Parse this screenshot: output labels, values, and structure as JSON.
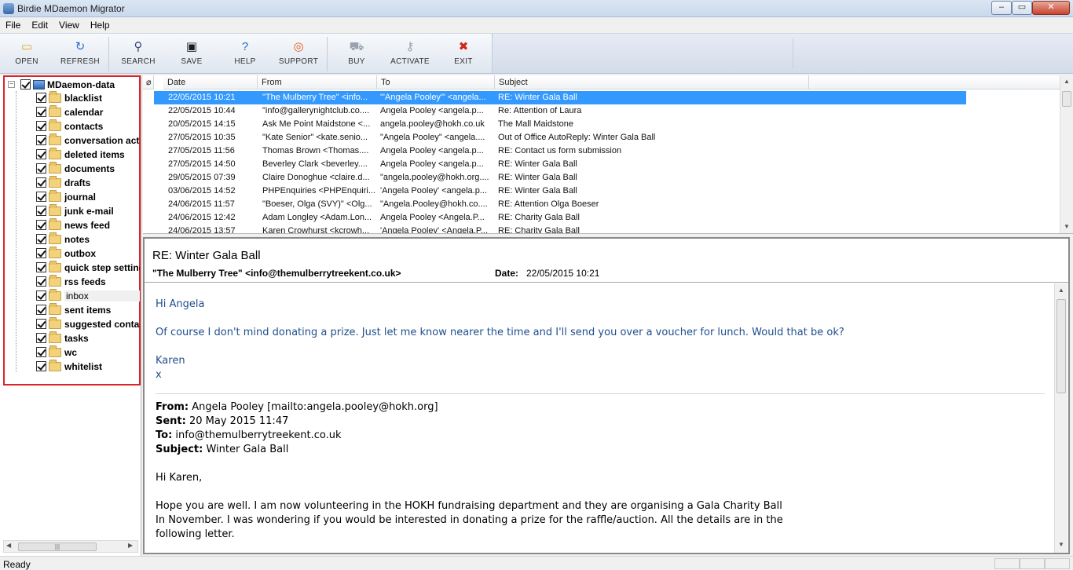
{
  "window": {
    "title": "Birdie MDaemon Migrator"
  },
  "menu": [
    "File",
    "Edit",
    "View",
    "Help"
  ],
  "toolbar": [
    {
      "label": "OPEN",
      "icon": "folder-open-icon",
      "glyph": "▭"
    },
    {
      "label": "REFRESH",
      "icon": "refresh-icon",
      "glyph": "↻"
    },
    {
      "label": "SEARCH",
      "icon": "search-icon",
      "glyph": "⚲"
    },
    {
      "label": "SAVE",
      "icon": "save-icon",
      "glyph": "▣"
    },
    {
      "label": "HELP",
      "icon": "help-icon",
      "glyph": "?"
    },
    {
      "label": "SUPPORT",
      "icon": "lifebuoy-icon",
      "glyph": "◎"
    },
    {
      "label": "BUY",
      "icon": "cart-icon",
      "glyph": "⛟"
    },
    {
      "label": "ACTIVATE",
      "icon": "key-icon",
      "glyph": "⚷"
    },
    {
      "label": "EXIT",
      "icon": "exit-icon",
      "glyph": "✖"
    }
  ],
  "tree": {
    "root": "MDaemon-data",
    "items": [
      "blacklist",
      "calendar",
      "contacts",
      "conversation acti",
      "deleted items",
      "documents",
      "drafts",
      "journal",
      "junk e-mail",
      "news feed",
      "notes",
      "outbox",
      "quick step setting",
      "rss feeds",
      "inbox",
      "sent items",
      "suggested contac",
      "tasks",
      "wc",
      "whitelist"
    ],
    "highlighted_item": "inbox"
  },
  "message_list": {
    "columns": [
      "Date",
      "From",
      "To",
      "Subject"
    ],
    "selected_index": 0,
    "rows": [
      {
        "date": "22/05/2015 10:21",
        "from": "\"The Mulberry Tree\" <info...",
        "to": "\"'Angela Pooley'\" <angela...",
        "subject": "RE: Winter Gala Ball"
      },
      {
        "date": "22/05/2015 10:44",
        "from": "\"info@gallerynightclub.co....",
        "to": "Angela Pooley <angela.p...",
        "subject": "Re: Attention of Laura"
      },
      {
        "date": "20/05/2015 14:15",
        "from": "Ask Me Point Maidstone <...",
        "to": "angela.pooley@hokh.co.uk",
        "subject": "The Mall Maidstone"
      },
      {
        "date": "27/05/2015 10:35",
        "from": "\"Kate Senior\" <kate.senio...",
        "to": "\"Angela Pooley\" <angela....",
        "subject": "Out of Office AutoReply: Winter Gala Ball"
      },
      {
        "date": "27/05/2015 11:56",
        "from": "Thomas Brown <Thomas....",
        "to": "Angela Pooley <angela.p...",
        "subject": "RE: Contact us form submission"
      },
      {
        "date": "27/05/2015 14:50",
        "from": "Beverley Clark <beverley....",
        "to": "Angela Pooley <angela.p...",
        "subject": "RE: Winter Gala Ball"
      },
      {
        "date": "29/05/2015 07:39",
        "from": "Claire Donoghue <claire.d...",
        "to": "\"angela.pooley@hokh.org....",
        "subject": "RE: Winter Gala Ball"
      },
      {
        "date": "03/06/2015 14:52",
        "from": "PHPEnquiries <PHPEnquiri...",
        "to": "'Angela Pooley' <angela.p...",
        "subject": "RE: Winter Gala Ball"
      },
      {
        "date": "24/06/2015 11:57",
        "from": "\"Boeser, Olga (SVY)\" <Olg...",
        "to": "\"Angela.Pooley@hokh.co....",
        "subject": "RE: Attention Olga Boeser"
      },
      {
        "date": "24/06/2015 12:42",
        "from": "Adam Longley <Adam.Lon...",
        "to": "Angela Pooley <Angela.P...",
        "subject": "RE: Charity Gala Ball"
      },
      {
        "date": "24/06/2015 13:57",
        "from": "Karen Crowhurst <kcrowh...",
        "to": "'Angela Pooley' <Angela.P...",
        "subject": "RE: Charity Gala Ball"
      }
    ]
  },
  "reader": {
    "subject": "RE: Winter Gala Ball",
    "from": "\"The Mulberry Tree\" <info@themulberrytreekent.co.uk>",
    "date_label": "Date:",
    "date_value": "22/05/2015 10:21",
    "greeting": "Hi Angela",
    "para1": "Of course I don't mind donating a prize.  Just let me know nearer the time and I'll send you over a voucher for lunch.  Would that be ok?",
    "sign1": "Karen",
    "sign2": "x",
    "quoted": {
      "from_label": "From:",
      "from_value": " Angela Pooley [mailto:angela.pooley@hokh.org]",
      "sent_label": "Sent:",
      "sent_value": " 20 May 2015 11:47",
      "to_label": "To:",
      "to_value": " info@themulberrytreekent.co.uk",
      "subject_label": "Subject:",
      "subject_value": " Winter Gala Ball",
      "greeting": "Hi Karen,",
      "line1": "Hope you are well. I am now volunteering in the HOKH fundraising department and they are organising a Gala Charity Ball",
      "line2": "In November. I was wondering if you would be interested in donating a prize for the raffle/auction. All the details are in the",
      "line3": "following letter."
    }
  },
  "status": {
    "text": "Ready"
  }
}
